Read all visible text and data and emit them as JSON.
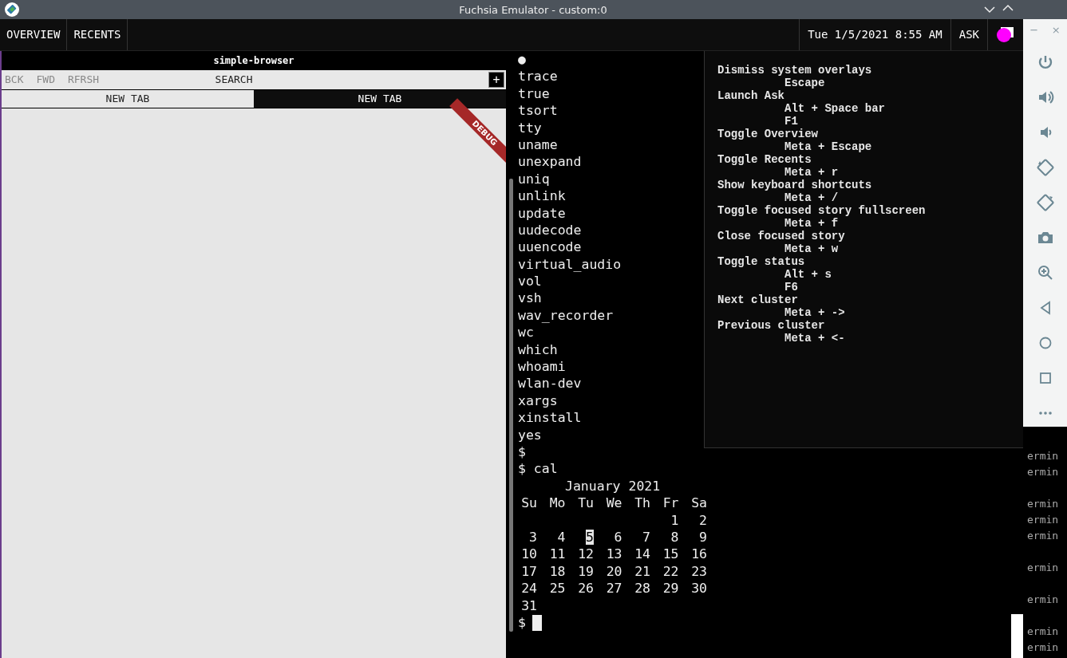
{
  "window": {
    "title": "Fuchsia Emulator - custom:0"
  },
  "top_bar": {
    "buttons": [
      "OVERVIEW",
      "RECENTS"
    ],
    "clock": "Tue 1/5/2021 8:55 AM",
    "ask": "ASK"
  },
  "browser": {
    "title": "simple-browser",
    "nav": [
      "BCK",
      "FWD",
      "RFRSH"
    ],
    "search": "SEARCH",
    "add": "+",
    "ribbon": "DEBUG",
    "tabs": [
      {
        "label": "NEW TAB",
        "selected": false
      },
      {
        "label": "NEW TAB",
        "selected": true
      }
    ]
  },
  "terminal": {
    "lines": [
      "●",
      "trace",
      "true",
      "tsort",
      "tty",
      "uname",
      "unexpand",
      "uniq",
      "unlink",
      "update",
      "uudecode",
      "uuencode",
      "virtual_audio",
      "vol",
      "vsh",
      "wav_recorder",
      "wc",
      "which",
      "whoami",
      "wlan-dev",
      "xargs",
      "xinstall",
      "yes",
      "$",
      "$ cal"
    ],
    "calendar": {
      "title": "January 2021",
      "weekdays": [
        "Su",
        "Mo",
        "Tu",
        "We",
        "Th",
        "Fr",
        "Sa"
      ],
      "weeks": [
        [
          {
            "d": "1",
            "selected": false
          },
          {
            "d": "2",
            "selected": false
          }
        ],
        [
          {
            "d": "3",
            "selected": false
          },
          {
            "d": "4",
            "selected": false
          },
          {
            "d": "5",
            "selected": true
          },
          {
            "d": "6",
            "selected": false
          },
          {
            "d": "7",
            "selected": false
          },
          {
            "d": "8",
            "selected": false
          },
          {
            "d": "9",
            "selected": false
          }
        ],
        [
          {
            "d": "10",
            "selected": false
          },
          {
            "d": "11",
            "selected": false
          },
          {
            "d": "12",
            "selected": false
          },
          {
            "d": "13",
            "selected": false
          },
          {
            "d": "14",
            "selected": false
          },
          {
            "d": "15",
            "selected": false
          },
          {
            "d": "16",
            "selected": false
          }
        ],
        [
          {
            "d": "17",
            "selected": false
          },
          {
            "d": "18",
            "selected": false
          },
          {
            "d": "19",
            "selected": false
          },
          {
            "d": "20",
            "selected": false
          },
          {
            "d": "21",
            "selected": false
          },
          {
            "d": "22",
            "selected": false
          },
          {
            "d": "23",
            "selected": false
          }
        ],
        [
          {
            "d": "24",
            "selected": false
          },
          {
            "d": "25",
            "selected": false
          },
          {
            "d": "26",
            "selected": false
          },
          {
            "d": "27",
            "selected": false
          },
          {
            "d": "28",
            "selected": false
          },
          {
            "d": "29",
            "selected": false
          },
          {
            "d": "30",
            "selected": false
          }
        ],
        [
          {
            "d": "31",
            "selected": false
          }
        ]
      ]
    },
    "prompt": "$"
  },
  "shortcuts": [
    {
      "action": "Dismiss system overlays",
      "keys": [
        "Escape"
      ]
    },
    {
      "action": "Launch Ask",
      "keys": [
        "Alt + Space bar",
        "F1"
      ]
    },
    {
      "action": "Toggle Overview",
      "keys": [
        "Meta + Escape"
      ]
    },
    {
      "action": "Toggle Recents",
      "keys": [
        "Meta + r"
      ]
    },
    {
      "action": "Show keyboard shortcuts",
      "keys": [
        "Meta + /"
      ]
    },
    {
      "action": "Toggle focused story fullscreen",
      "keys": [
        "Meta + f"
      ]
    },
    {
      "action": "Close focused story",
      "keys": [
        "Meta + w"
      ]
    },
    {
      "action": "Toggle status",
      "keys": [
        "Alt + s",
        "F6"
      ]
    },
    {
      "action": "Next cluster",
      "keys": [
        "Meta + ->"
      ]
    },
    {
      "action": "Previous cluster",
      "keys": [
        "Meta + <-"
      ]
    }
  ],
  "side_toolbar": {
    "minimize": "−",
    "close": "×"
  },
  "background_window": {
    "lines": [
      {
        "kind": "blank"
      },
      {
        "kind": "text",
        "text": "ermin"
      },
      {
        "kind": "text",
        "text": "ermin"
      },
      {
        "kind": "blank"
      },
      {
        "kind": "text",
        "text": "ermin"
      },
      {
        "kind": "text",
        "text": "ermin"
      },
      {
        "kind": "text",
        "text": "ermin"
      },
      {
        "kind": "blank"
      },
      {
        "kind": "text",
        "text": "ermin"
      },
      {
        "kind": "blank"
      },
      {
        "kind": "text",
        "text": "ermin"
      },
      {
        "kind": "blank"
      },
      {
        "kind": "text",
        "text": "ermin"
      },
      {
        "kind": "text",
        "text": "ermin"
      }
    ]
  }
}
